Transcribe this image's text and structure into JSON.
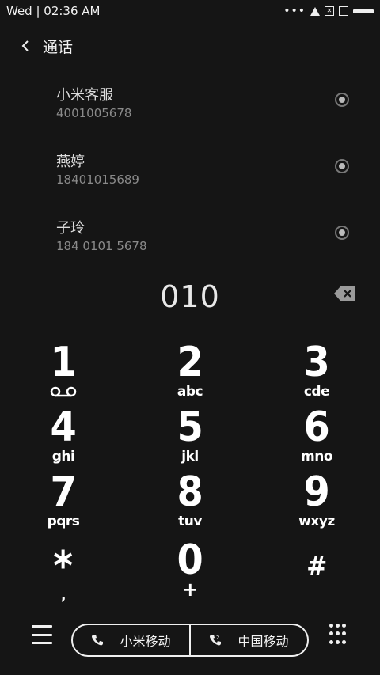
{
  "status": {
    "time": "Wed | 02:36  AM",
    "icons": [
      "more-dots-icon",
      "alert-triangle-icon",
      "no-sim-icon",
      "sim-card-icon",
      "battery-icon"
    ]
  },
  "header": {
    "title": "通话",
    "back_icon": "chevron-left-icon"
  },
  "contacts": [
    {
      "name": "小米客服",
      "number": "4001005678"
    },
    {
      "name": "燕婷",
      "number": "18401015689"
    },
    {
      "name": "子玲",
      "number": "184 0101 5678"
    }
  ],
  "dial": {
    "digits": "010"
  },
  "keypad": [
    {
      "digit": "1",
      "letters": ""
    },
    {
      "digit": "2",
      "letters": "abc"
    },
    {
      "digit": "3",
      "letters": "cde"
    },
    {
      "digit": "4",
      "letters": "ghi"
    },
    {
      "digit": "5",
      "letters": "jkl"
    },
    {
      "digit": "6",
      "letters": "mno"
    },
    {
      "digit": "7",
      "letters": "pqrs"
    },
    {
      "digit": "8",
      "letters": "tuv"
    },
    {
      "digit": "9",
      "letters": "wxyz"
    },
    {
      "digit": "*",
      "letters": ","
    },
    {
      "digit": "0",
      "letters": "+"
    },
    {
      "digit": "#",
      "letters": ""
    }
  ],
  "bottom": {
    "sim1_label": "小米移动",
    "sim2_label": "中国移动",
    "menu_icon": "menu-icon",
    "dialpad_icon": "dialpad-grid-icon"
  },
  "colors": {
    "background": "#151515",
    "text": "#ffffff",
    "muted": "#8a8a8a"
  }
}
